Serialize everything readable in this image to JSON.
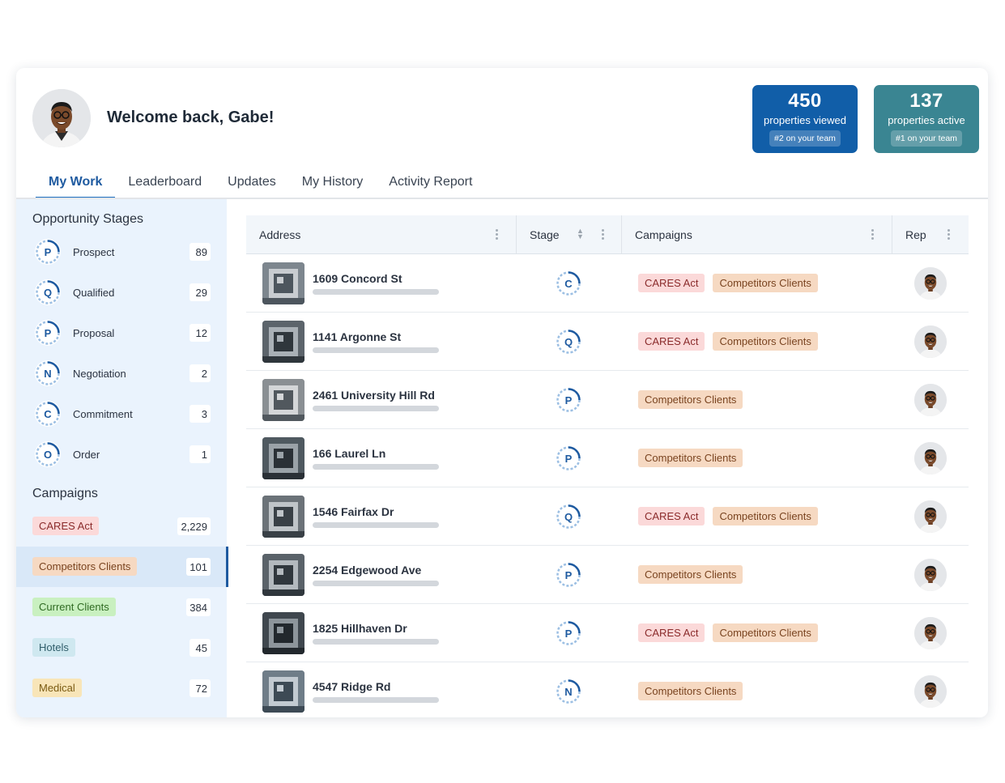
{
  "header": {
    "welcome": "Welcome back, Gabe!",
    "stats": [
      {
        "value": "450",
        "label": "properties viewed",
        "rank": "#2 on your team",
        "color": "#115ea8"
      },
      {
        "value": "137",
        "label": "properties active",
        "rank": "#1 on your team",
        "color": "#3a8592"
      }
    ]
  },
  "tabs": [
    {
      "label": "My Work",
      "active": true
    },
    {
      "label": "Leaderboard"
    },
    {
      "label": "Updates"
    },
    {
      "label": "My History"
    },
    {
      "label": "Activity Report"
    }
  ],
  "sidebar": {
    "stages_title": "Opportunity Stages",
    "stages": [
      {
        "letter": "P",
        "name": "Prospect",
        "count": "89"
      },
      {
        "letter": "Q",
        "name": "Qualified",
        "count": "29"
      },
      {
        "letter": "P",
        "name": "Proposal",
        "count": "12"
      },
      {
        "letter": "N",
        "name": "Negotiation",
        "count": "2"
      },
      {
        "letter": "C",
        "name": "Commitment",
        "count": "3"
      },
      {
        "letter": "O",
        "name": "Order",
        "count": "1"
      }
    ],
    "campaigns_title": "Campaigns",
    "campaigns": [
      {
        "name": "CARES Act",
        "count": "2,229"
      },
      {
        "name": "Competitors Clients",
        "count": "101",
        "selected": true
      },
      {
        "name": "Current Clients",
        "count": "384"
      },
      {
        "name": "Hotels",
        "count": "45"
      },
      {
        "name": "Medical",
        "count": "72"
      }
    ]
  },
  "table": {
    "columns": {
      "address": "Address",
      "stage": "Stage",
      "campaigns": "Campaigns",
      "rep": "Rep"
    },
    "rows": [
      {
        "address": "1609 Concord St",
        "stage": "C",
        "campaigns": [
          "CARES Act",
          "Competitors Clients"
        ]
      },
      {
        "address": "1141 Argonne St",
        "stage": "Q",
        "campaigns": [
          "CARES Act",
          "Competitors Clients"
        ]
      },
      {
        "address": "2461 University Hill Rd",
        "stage": "P",
        "campaigns": [
          "Competitors Clients"
        ]
      },
      {
        "address": "166 Laurel Ln",
        "stage": "P",
        "campaigns": [
          "Competitors Clients"
        ]
      },
      {
        "address": "1546 Fairfax Dr",
        "stage": "Q",
        "campaigns": [
          "CARES Act",
          "Competitors Clients"
        ]
      },
      {
        "address": "2254 Edgewood Ave",
        "stage": "P",
        "campaigns": [
          "Competitors Clients"
        ]
      },
      {
        "address": "1825 Hillhaven Dr",
        "stage": "P",
        "campaigns": [
          "CARES Act",
          "Competitors Clients"
        ]
      },
      {
        "address": "4547 Ridge Rd",
        "stage": "N",
        "campaigns": [
          "Competitors Clients"
        ]
      }
    ]
  },
  "colors": {
    "accent": "#1e5aa0",
    "sidebar_bg": "#eaf3fd"
  }
}
